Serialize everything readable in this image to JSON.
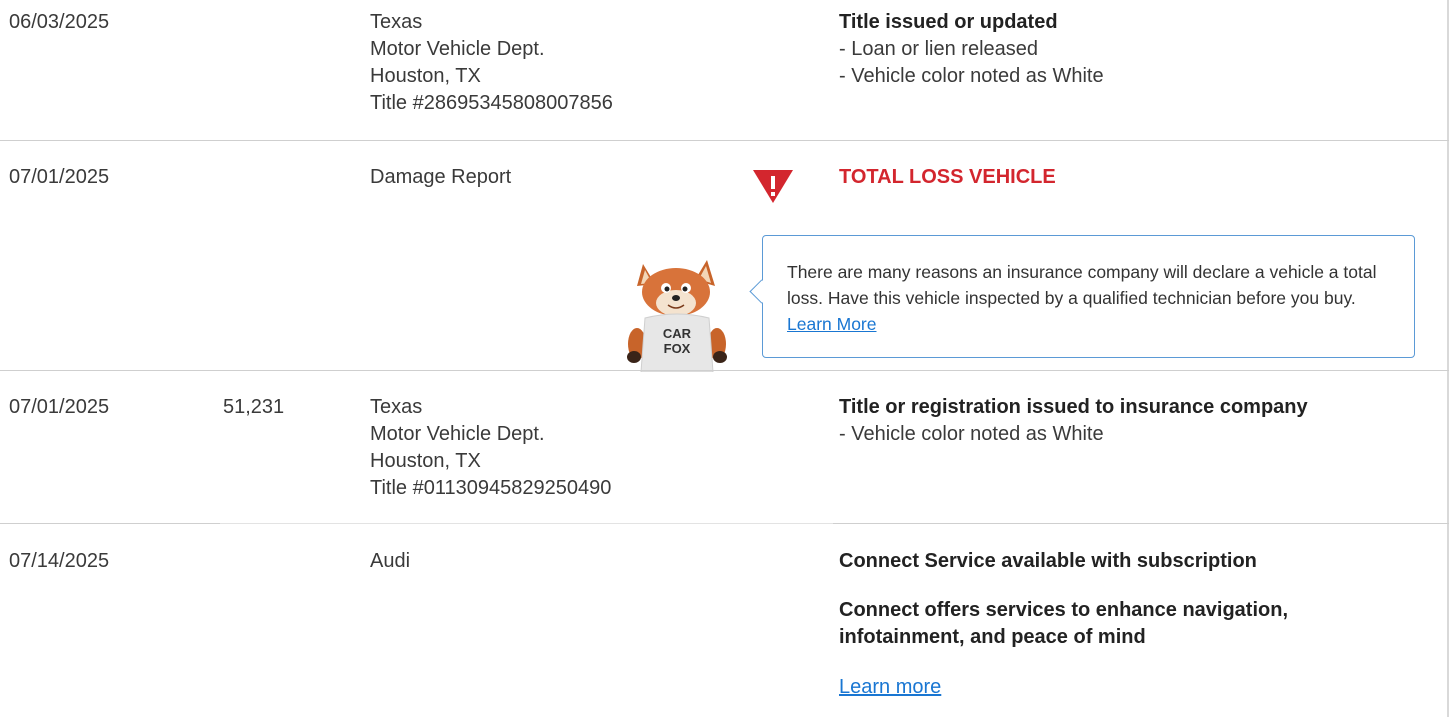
{
  "records": [
    {
      "date": "06/03/2025",
      "odometer": "",
      "source": [
        "Texas",
        "Motor Vehicle Dept.",
        "Houston, TX",
        "Title #28695345808007856"
      ],
      "comment_title": "Title issued or updated",
      "comment_lines": [
        "- Loan or lien released",
        "- Vehicle color noted as White"
      ]
    },
    {
      "date": "07/01/2025",
      "odometer": "",
      "source": [
        "Damage Report"
      ],
      "alert_title": "TOTAL LOSS VEHICLE",
      "callout": {
        "text": "There are many reasons an insurance company will declare a vehicle a total loss. Have this vehicle inspected by a qualified technician before you buy. ",
        "link": "Learn More"
      },
      "mascot_text": [
        "CAR",
        "FOX"
      ]
    },
    {
      "date": "07/01/2025",
      "odometer": "51,231",
      "source": [
        "Texas",
        "Motor Vehicle Dept.",
        "Houston, TX",
        "Title #01130945829250490"
      ],
      "comment_title": "Title or registration issued to insurance company",
      "comment_lines": [
        "- Vehicle color noted as White"
      ]
    },
    {
      "date": "07/14/2025",
      "odometer": "",
      "source": [
        "Audi"
      ],
      "comment_title": "Connect Service available with subscription",
      "comment_title2": [
        "Connect offers services to enhance navigation,",
        "infotainment, and peace of mind"
      ],
      "link": "Learn more"
    }
  ],
  "colors": {
    "alert": "#d3262e",
    "link": "#1976d2",
    "callout_border": "#5b9ad6"
  },
  "icons": [
    "warning-triangle-icon",
    "carfox-mascot"
  ]
}
